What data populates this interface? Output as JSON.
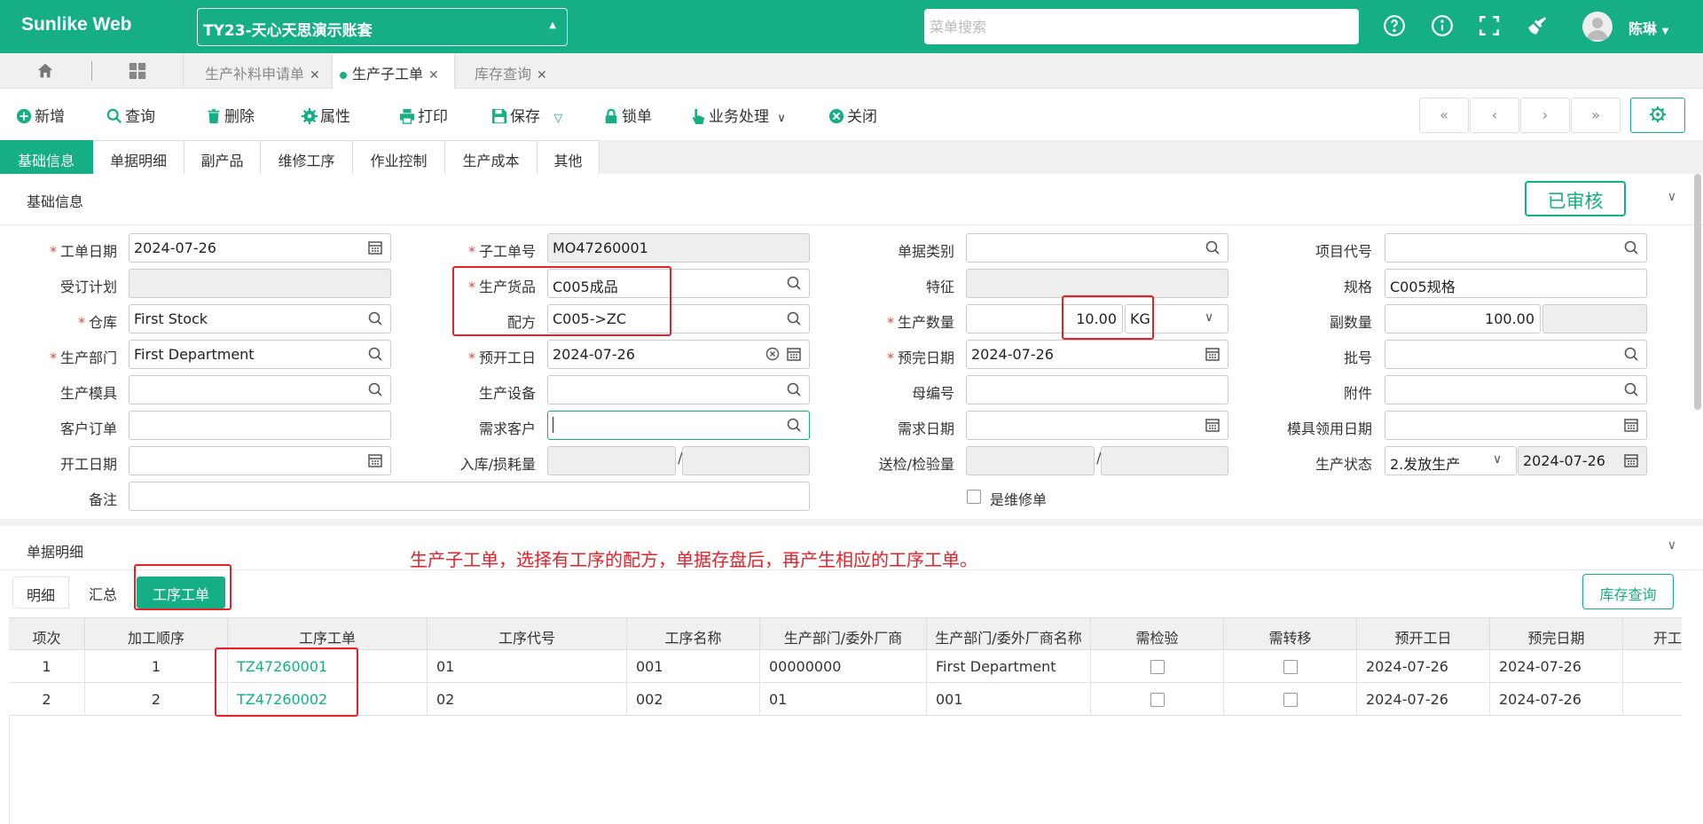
{
  "header": {
    "brand": "Sunlike Web",
    "account": "TY23-天心天思演示账套",
    "search_placeholder": "菜单搜索",
    "user": "陈琳"
  },
  "page_tabs": [
    {
      "label": "生产补料申请单",
      "active": false
    },
    {
      "label": "生产子工单",
      "active": true
    },
    {
      "label": "库存查询",
      "active": false
    }
  ],
  "toolbar": {
    "new": "新增",
    "query": "查询",
    "delete": "删除",
    "props": "属性",
    "print": "打印",
    "save": "保存",
    "lock": "锁单",
    "business": "业务处理",
    "close": "关闭"
  },
  "nav": {
    "first": "«",
    "prev": "‹",
    "next": "›",
    "last": "»"
  },
  "sub_tabs": [
    "基础信息",
    "单据明细",
    "副产品",
    "维修工序",
    "作业控制",
    "生产成本",
    "其他"
  ],
  "basic": {
    "title": "基础信息",
    "status_stamp": "已审核",
    "labels": {
      "order_date": "工单日期",
      "sub_order_no": "子工单号",
      "doc_type": "单据类别",
      "project_code": "项目代号",
      "order_plan": "受订计划",
      "product": "生产货品",
      "feature": "特征",
      "spec": "规格",
      "warehouse": "仓库",
      "formula": "配方",
      "qty": "生产数量",
      "sub_qty": "副数量",
      "dept": "生产部门",
      "plan_start": "预开工日",
      "plan_finish": "预完日期",
      "batch": "批号",
      "mold": "生产模具",
      "equipment": "生产设备",
      "parent_no": "母编号",
      "attachment": "附件",
      "customer_order": "客户订单",
      "demand_customer": "需求客户",
      "demand_date": "需求日期",
      "mold_date": "模具领用日期",
      "start_date": "开工日期",
      "in_loss": "入库/损耗量",
      "inspect": "送检/检验量",
      "prod_status": "生产状态",
      "remark": "备注",
      "is_repair": "是维修单"
    },
    "values": {
      "order_date": "2024-07-26",
      "sub_order_no": "MO47260001",
      "product": "C005成品",
      "spec": "C005规格",
      "warehouse": "First Stock",
      "formula": "C005->ZC",
      "qty": "10.00",
      "unit": "KG",
      "sub_qty": "100.00",
      "dept": "First Department",
      "plan_start": "2024-07-26",
      "plan_finish": "2024-07-26",
      "prod_status": "2.发放生产",
      "status_date": "2024-07-26"
    }
  },
  "detail": {
    "title": "单据明细",
    "annotation": "生产子工单，选择有工序的配方，单据存盘后，再产生相应的工序工单。",
    "tabs": [
      "明细",
      "汇总",
      "工序工单"
    ],
    "stock_query": "库存查询",
    "columns": [
      "项次",
      "加工顺序",
      "工序工单",
      "工序代号",
      "工序名称",
      "生产部门/委外厂商",
      "生产部门/委外厂商名称",
      "需检验",
      "需转移",
      "预开工日",
      "预完日期",
      "开工"
    ],
    "rows": [
      {
        "idx": "1",
        "seq": "1",
        "wo": "TZ47260001",
        "op_code": "01",
        "op_name": "001",
        "dept": "00000000",
        "dept_name": "First Department",
        "start": "2024-07-26",
        "finish": "2024-07-26"
      },
      {
        "idx": "2",
        "seq": "2",
        "wo": "TZ47260002",
        "op_code": "02",
        "op_name": "002",
        "dept": "01",
        "dept_name": "001",
        "start": "2024-07-26",
        "finish": "2024-07-26"
      }
    ]
  },
  "colors": {
    "brand": "#16ae85",
    "highlight": "#e8202a"
  }
}
